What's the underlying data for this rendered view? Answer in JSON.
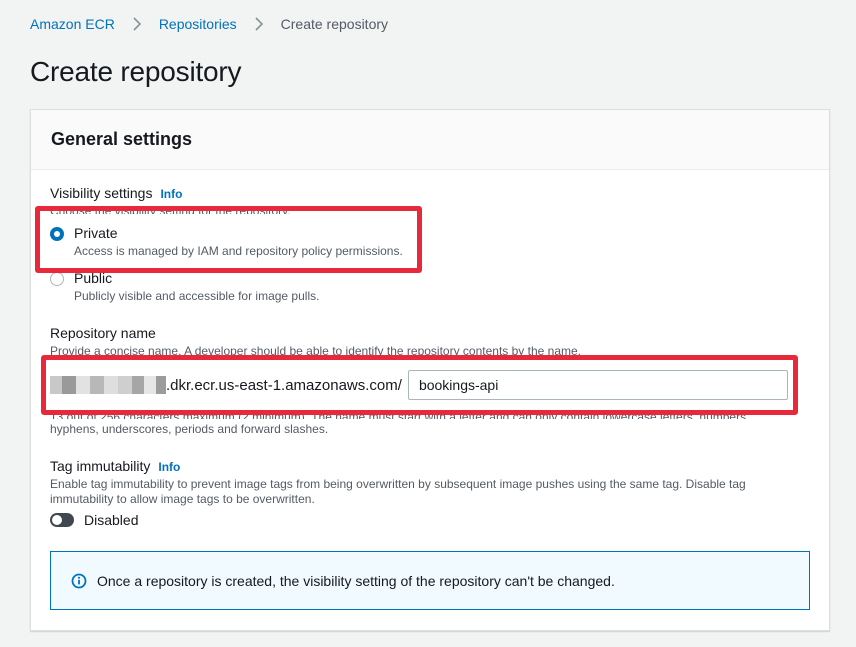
{
  "breadcrumb": {
    "items": [
      "Amazon ECR",
      "Repositories"
    ],
    "current": "Create repository"
  },
  "page": {
    "title": "Create repository"
  },
  "general_settings": {
    "title": "General settings",
    "visibility": {
      "label": "Visibility settings",
      "info": "Info",
      "description": "Choose the visibility setting for the repository.",
      "options": [
        {
          "label": "Private",
          "description": "Access is managed by IAM and repository policy permissions.",
          "selected": true
        },
        {
          "label": "Public",
          "description": "Publicly visible and accessible for image pulls.",
          "selected": false
        }
      ]
    },
    "repository_name": {
      "label": "Repository name",
      "description": "Provide a concise name. A developer should be able to identify the repository contents by the name.",
      "uri_prefix": ".dkr.ecr.us-east-1.amazonaws.com/",
      "value": "bookings-api",
      "constraint_line1": "13 out of 256 characters maximum (2 minimum). The name must start with a letter and can only contain lowercase letters, numbers,",
      "constraint_line2": "hyphens, underscores, periods and forward slashes."
    },
    "tag_immutability": {
      "label": "Tag immutability",
      "info": "Info",
      "description_line1": "Enable tag immutability to prevent image tags from being overwritten by subsequent image pushes using the same tag. Disable tag",
      "description_line2": "immutability to allow image tags to be overwritten.",
      "toggle_label": "Disabled",
      "enabled": false
    },
    "alert": {
      "icon": "info-circle-icon",
      "text": "Once a repository is created, the visibility setting of the repository can't be changed."
    }
  },
  "colors": {
    "link": "#0073bb",
    "highlight": "#e8293b",
    "alert_bg": "#f1faff"
  }
}
